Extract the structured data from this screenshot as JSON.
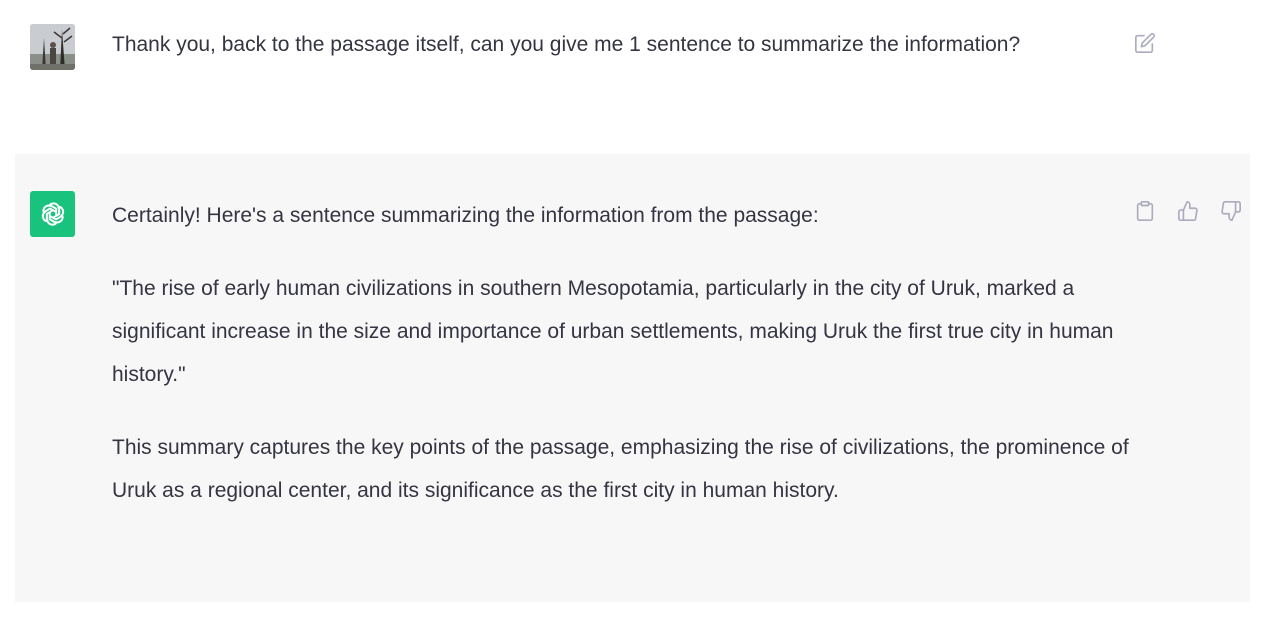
{
  "user_message": {
    "text": "Thank you, back to the passage itself, can you give me 1 sentence to summarize the information?"
  },
  "assistant_message": {
    "paragraphs": [
      "Certainly! Here's a sentence summarizing the information from the passage:",
      "\"The rise of early human civilizations in southern Mesopotamia, particularly in the city of Uruk, marked a significant increase in the size and importance of urban settlements, making Uruk the first true city in human history.\"",
      "This summary captures the key points of the passage, emphasizing the rise of civilizations, the prominence of Uruk as a regional center, and its significance as the first city in human history."
    ]
  },
  "icons": {
    "user_avatar": "user-avatar",
    "assistant_avatar": "openai-logo-icon",
    "edit": "edit-icon",
    "copy": "clipboard-icon",
    "thumbs_up": "thumbs-up-icon",
    "thumbs_down": "thumbs-down-icon"
  },
  "colors": {
    "assistant_background": "#f7f7f8",
    "assistant_avatar_background": "#19c37d",
    "text": "#343541",
    "icon": "#acacbe"
  }
}
